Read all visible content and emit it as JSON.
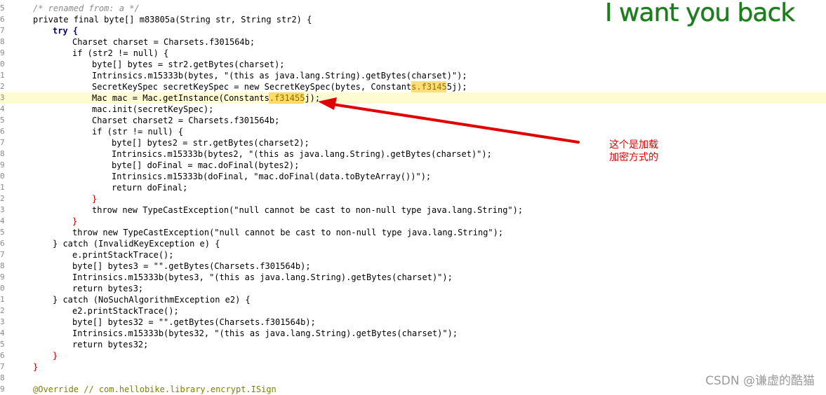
{
  "overlay": {
    "title": "I want you back",
    "note_line1": "这个是加载",
    "note_line2": "加密方式的",
    "watermark": "CSDN @谦虚的酷猫"
  },
  "colors": {
    "highlight_line": "#fffbd0",
    "selection": "#ffc107",
    "arrow": "#e00000",
    "title": "#1a7f1a"
  },
  "code": {
    "lines": [
      {
        "gutter": "5",
        "text": "/* renamed from: a */"
      },
      {
        "gutter": "6",
        "text": "private final byte[] m83805a(String str, String str2) {"
      },
      {
        "gutter": "7",
        "text": "try {"
      },
      {
        "gutter": "8",
        "text": "Charset charset = Charsets.f301564b;"
      },
      {
        "gutter": "9",
        "text": "if (str2 != null) {"
      },
      {
        "gutter": "0",
        "text": "byte[] bytes = str2.getBytes(charset);"
      },
      {
        "gutter": "1",
        "text": "Intrinsics.m15333b(bytes, \"(this as java.lang.String).getBytes(charset)\");"
      },
      {
        "gutter": "2",
        "text": "SecretKeySpec secretKeySpec = new SecretKeySpec(bytes, Constants.f31455j);"
      },
      {
        "gutter": "3",
        "text": "Mac mac = Mac.getInstance(Constants.f31455j);"
      },
      {
        "gutter": "4",
        "text": "mac.init(secretKeySpec);"
      },
      {
        "gutter": "5",
        "text": "Charset charset2 = Charsets.f301564b;"
      },
      {
        "gutter": "6",
        "text": "if (str != null) {"
      },
      {
        "gutter": "7",
        "text": "byte[] bytes2 = str.getBytes(charset2);"
      },
      {
        "gutter": "8",
        "text": "Intrinsics.m15333b(bytes2, \"(this as java.lang.String).getBytes(charset)\");"
      },
      {
        "gutter": "9",
        "text": "byte[] doFinal = mac.doFinal(bytes2);"
      },
      {
        "gutter": "0",
        "text": "Intrinsics.m15333b(doFinal, \"mac.doFinal(data.toByteArray())\");"
      },
      {
        "gutter": "1",
        "text": "return doFinal;"
      },
      {
        "gutter": "2",
        "text": "}"
      },
      {
        "gutter": "3",
        "text": "throw new TypeCastException(\"null cannot be cast to non-null type java.lang.String\");"
      },
      {
        "gutter": "4",
        "text": "}"
      },
      {
        "gutter": "5",
        "text": "throw new TypeCastException(\"null cannot be cast to non-null type java.lang.String\");"
      },
      {
        "gutter": "6",
        "text": "} catch (InvalidKeyException e) {"
      },
      {
        "gutter": "7",
        "text": "e.printStackTrace();"
      },
      {
        "gutter": "8",
        "text": "byte[] bytes3 = \"\".getBytes(Charsets.f301564b);"
      },
      {
        "gutter": "9",
        "text": "Intrinsics.m15333b(bytes3, \"(this as java.lang.String).getBytes(charset)\");"
      },
      {
        "gutter": "0",
        "text": "return bytes3;"
      },
      {
        "gutter": "1",
        "text": "} catch (NoSuchAlgorithmException e2) {"
      },
      {
        "gutter": "2",
        "text": "e2.printStackTrace();"
      },
      {
        "gutter": "3",
        "text": "byte[] bytes32 = \"\".getBytes(Charsets.f301564b);"
      },
      {
        "gutter": "4",
        "text": "Intrinsics.m15333b(bytes32, \"(this as java.lang.String).getBytes(charset)\");"
      },
      {
        "gutter": "5",
        "text": "return bytes32;"
      },
      {
        "gutter": "6",
        "text": "}"
      },
      {
        "gutter": "7",
        "text": "}"
      },
      {
        "gutter": "8",
        "text": ""
      },
      {
        "gutter": "9",
        "text": "@Override // com.hellobike.library.encrypt.ISign"
      }
    ]
  }
}
